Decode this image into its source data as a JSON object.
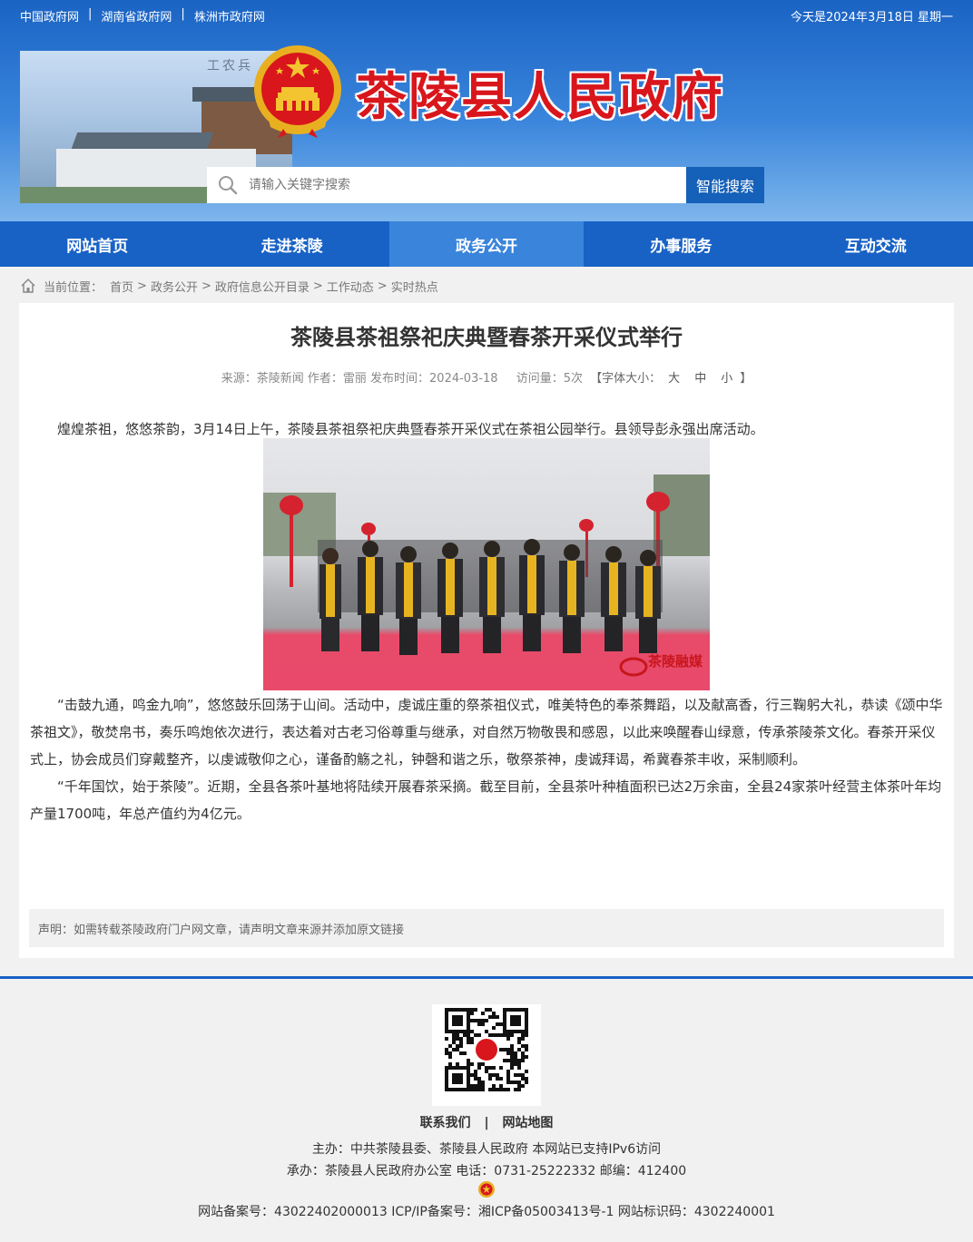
{
  "top_links": [
    "中国政府网",
    "湖南省政府网",
    "株洲市政府网"
  ],
  "top_links_sep": "|",
  "date_text": "今天是2024年3月18日 星期一",
  "header_slogan": "工农兵",
  "site_title": "茶陵县人民政府",
  "search": {
    "placeholder": "请输入关键字搜索",
    "button": "智能搜索"
  },
  "nav": [
    "网站首页",
    "走进茶陵",
    "政务公开",
    "办事服务",
    "互动交流"
  ],
  "nav_active_index": 2,
  "breadcrumb": {
    "label": "当前位置：",
    "items": [
      "首页",
      "政务公开",
      "政府信息公开目录",
      "工作动态",
      "实时热点"
    ],
    "sep": ">"
  },
  "article": {
    "title": "茶陵县茶祖祭祀庆典暨春茶开采仪式举行",
    "meta": {
      "source": "来源：茶陵新闻 作者：雷丽 发布时间：2024-03-18",
      "views": "访问量：5次",
      "font_size_label": "【字体大小：",
      "font_sizes": [
        "大",
        "中",
        "小"
      ],
      "font_size_close": "】"
    },
    "lead": "煌煌茶祖，悠悠茶韵，3月14日上午，茶陵县茶祖祭祀庆典暨春茶开采仪式在茶祖公园举行。县领导彭永强出席活动。",
    "photo_watermark": "茶陵融媒",
    "paragraphs": [
      "“击鼓九通，鸣金九响”，悠悠鼓乐回荡于山间。活动中，虔诚庄重的祭茶祖仪式，唯美特色的奉茶舞蹈，以及献高香，行三鞠躬大礼，恭读《颂中华茶祖文》，敬焚帛书，奏乐鸣炮依次进行，表达着对古老习俗尊重与继承，对自然万物敬畏和感恩，以此来唤醒春山绿意，传承茶陵茶文化。春茶开采仪式上，协会成员们穿戴整齐，以虔诚敬仰之心，谨备酌觞之礼，钟磬和谐之乐，敬祭茶神，虔诚拜谒，希冀春茶丰收，采制顺利。",
      "“千年国饮，始于茶陵”。近期，全县各茶叶基地将陆续开展春茶采摘。截至目前，全县茶叶种植面积已达2万余亩，全县24家茶叶经营主体茶叶年均产量1700吨，年总产值约为4亿元。"
    ],
    "notice": "声明：如需转载茶陵政府门户网文章，请声明文章来源并添加原文链接"
  },
  "footer": {
    "links": [
      "联系我们",
      "网站地图"
    ],
    "links_sep": "|",
    "host": "主办：中共茶陵县委、茶陵县人民政府 本网站已支持IPv6访问",
    "organizer": "承办：茶陵县人民政府办公室 电话：0731-25222332 邮编：412400",
    "records": "网站备案号：43022402000013 ICP/IP备案号：湘ICP备05003413号-1 网站标识码：4302240001"
  },
  "colors": {
    "brand_blue": "#1862c6",
    "active_blue": "#3a84db",
    "title_red": "#d8161c"
  }
}
